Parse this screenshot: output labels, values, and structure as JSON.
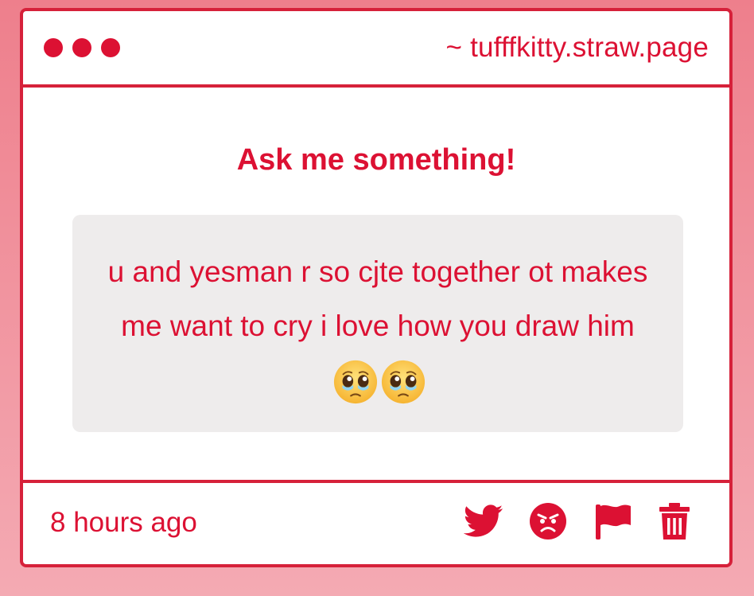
{
  "window": {
    "url": "~ tufffkitty.straw.page"
  },
  "card": {
    "heading": "Ask me something!",
    "message": "u and yesman r so cjte together ot makes me want to cry i love how you draw him",
    "emoji": [
      "pleading-face-emoji",
      "pleading-face-emoji"
    ]
  },
  "footer": {
    "timestamp": "8 hours ago",
    "actions": [
      "twitter-icon",
      "angry-face-icon",
      "flag-icon",
      "trash-icon"
    ]
  },
  "colors": {
    "accent": "#dc1133",
    "background_top": "#ee7f8c",
    "background_bottom": "#f4aab3",
    "message_background": "#eeecec"
  }
}
